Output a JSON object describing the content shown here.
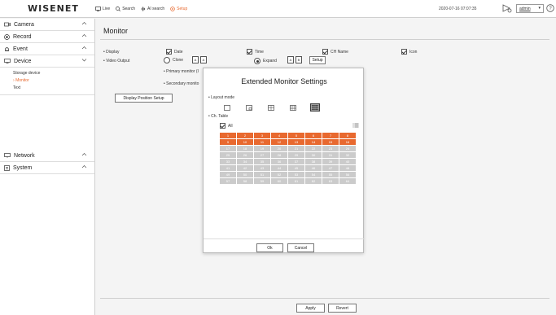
{
  "topbar": {
    "logo": "WISENET",
    "nav": [
      {
        "label": "Live",
        "icon": "monitor-icon"
      },
      {
        "label": "Search",
        "icon": "search-icon"
      },
      {
        "label": "AI search",
        "icon": "ai-search-icon"
      },
      {
        "label": "Setup",
        "icon": "setup-icon"
      }
    ],
    "datetime": "2020-07-16 07:07:35",
    "user": "admin",
    "accent": "#e8692f"
  },
  "sidebar": {
    "items": [
      {
        "label": "Camera",
        "icon": "camera-icon"
      },
      {
        "label": "Record",
        "icon": "record-icon"
      },
      {
        "label": "Event",
        "icon": "bell-icon"
      },
      {
        "label": "Device",
        "icon": "device-icon"
      },
      {
        "label": "Network",
        "icon": "network-icon"
      },
      {
        "label": "System",
        "icon": "system-icon"
      }
    ],
    "device_submenu": [
      "Storage device",
      "Monitor",
      "Text"
    ]
  },
  "main": {
    "title": "Monitor",
    "display_label": "Display",
    "display_options": [
      "Date",
      "Time",
      "CH Name",
      "Icon"
    ],
    "video_output_label": "Video Output",
    "clone_label": "Clone",
    "expand_label": "Expand",
    "setup_button": "Setup",
    "primary_monitor": "Primary monitor (I",
    "secondary_monitor": "Secondary monito",
    "display_position_button": "Display Position Setup",
    "apply_button": "Apply",
    "revert_button": "Revert"
  },
  "modal": {
    "title": "Extended Monitor Settings",
    "layout_mode_label": "Layout mode",
    "ch_table_label": "Ch. Table",
    "all_label": "All",
    "rows": [
      [
        "1",
        "2",
        "3",
        "4",
        "5",
        "6",
        "7",
        "8"
      ],
      [
        "9",
        "10",
        "11",
        "12",
        "13",
        "14",
        "15",
        "16"
      ],
      [
        "17",
        "18",
        "19",
        "20",
        "21",
        "22",
        "23",
        "24"
      ],
      [
        "25",
        "26",
        "27",
        "28",
        "29",
        "30",
        "31",
        "32"
      ],
      [
        "33",
        "34",
        "35",
        "36",
        "37",
        "38",
        "39",
        "40"
      ],
      [
        "41",
        "42",
        "43",
        "44",
        "45",
        "46",
        "47",
        "48"
      ],
      [
        "49",
        "50",
        "51",
        "52",
        "53",
        "54",
        "55",
        "56"
      ],
      [
        "57",
        "58",
        "59",
        "60",
        "61",
        "62",
        "63",
        "64"
      ]
    ],
    "active_rows": 2,
    "ok_button": "Ok",
    "cancel_button": "Cancel"
  }
}
